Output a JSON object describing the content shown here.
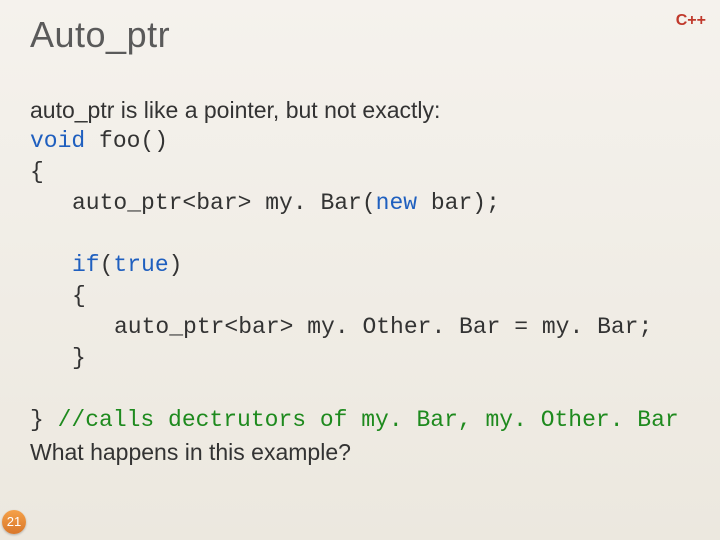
{
  "tagline": "C++",
  "title": "Auto_ptr",
  "intro": "auto_ptr is like a pointer, but not exactly:",
  "code": {
    "l1_kw": "void",
    "l1_rest": " foo()",
    "l2": "{",
    "l3_a": "auto_ptr<bar> my. Bar(",
    "l3_kw": "new",
    "l3_b": " bar);",
    "l4_kw": "if",
    "l4_a": "(",
    "l4_kw2": "true",
    "l4_b": ")",
    "l5": "{",
    "l6": "auto_ptr<bar> my. Other. Bar = my. Bar;",
    "l7": "}",
    "l8_a": "} ",
    "l8_comment": "//calls dectrutors of my. Bar, my. Other. Bar"
  },
  "question": "What happens in this example?",
  "slide_number": "21"
}
